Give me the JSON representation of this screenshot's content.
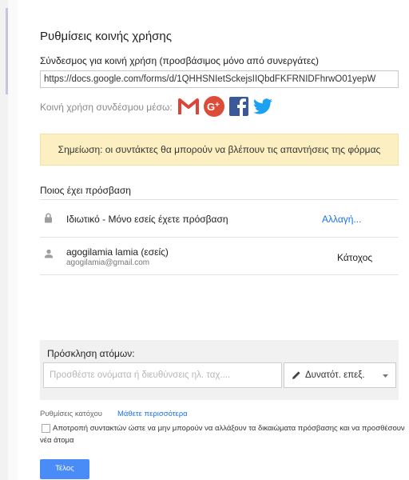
{
  "dialog": {
    "title": "Ρυθμίσεις κοινής χρήσης",
    "link_label": "Σύνδεσμος για κοινή χρήση (προσβάσιμος μόνο από συνεργάτες)",
    "link_url": "https://docs.google.com/forms/d/1QHHSNIetSckejsIIQbdFKFRNIDFhrwO01yepW",
    "share_via_label": "Κοινή χρήση συνδέσμου μέσω:",
    "share_icons": [
      "gmail-icon",
      "google-plus-icon",
      "facebook-icon",
      "twitter-icon"
    ],
    "note": "Σημείωση: οι συντάκτες θα μπορούν να βλέπουν τις απαντήσεις της φόρμας",
    "who_has_access": "Ποιος έχει πρόσβαση",
    "visibility": {
      "icon": "lock-icon",
      "text": "Ιδιωτικό - Μόνο εσείς έχετε πρόσβαση",
      "change_link": "Αλλαγή..."
    },
    "owner": {
      "icon": "person-icon",
      "name": "agogilamia lamia (εσείς)",
      "email": "agogilamia@gmail.com",
      "role": "Κάτοχος"
    },
    "invite": {
      "title": "Πρόσκληση ατόμων:",
      "placeholder": "Προσθέστε ονόματα ή διευθύνσεις ηλ. ταχ....",
      "permission_label": "Δυνατότ. επεξ."
    },
    "owner_settings": {
      "label": "Ρυθμίσεις κατόχου",
      "learn_more": "Μάθετε περισσότερα"
    },
    "restrict_checkbox": {
      "checked": false,
      "label": "Αποτροπή συντακτών ώστε να μην μπορούν να αλλάξουν τα δικαιώματα πρόσβασης και να προσθέσουν νέα άτομα"
    },
    "done_button": "Τέλος"
  },
  "colors": {
    "gmail_red": "#db4437",
    "google_plus_red": "#dd4b39",
    "facebook_blue": "#3b5998",
    "twitter_blue": "#1da1f2",
    "note_background": "#fcf0c3",
    "link_blue": "#1a73e8",
    "primary_button": "#4a8cf7"
  }
}
